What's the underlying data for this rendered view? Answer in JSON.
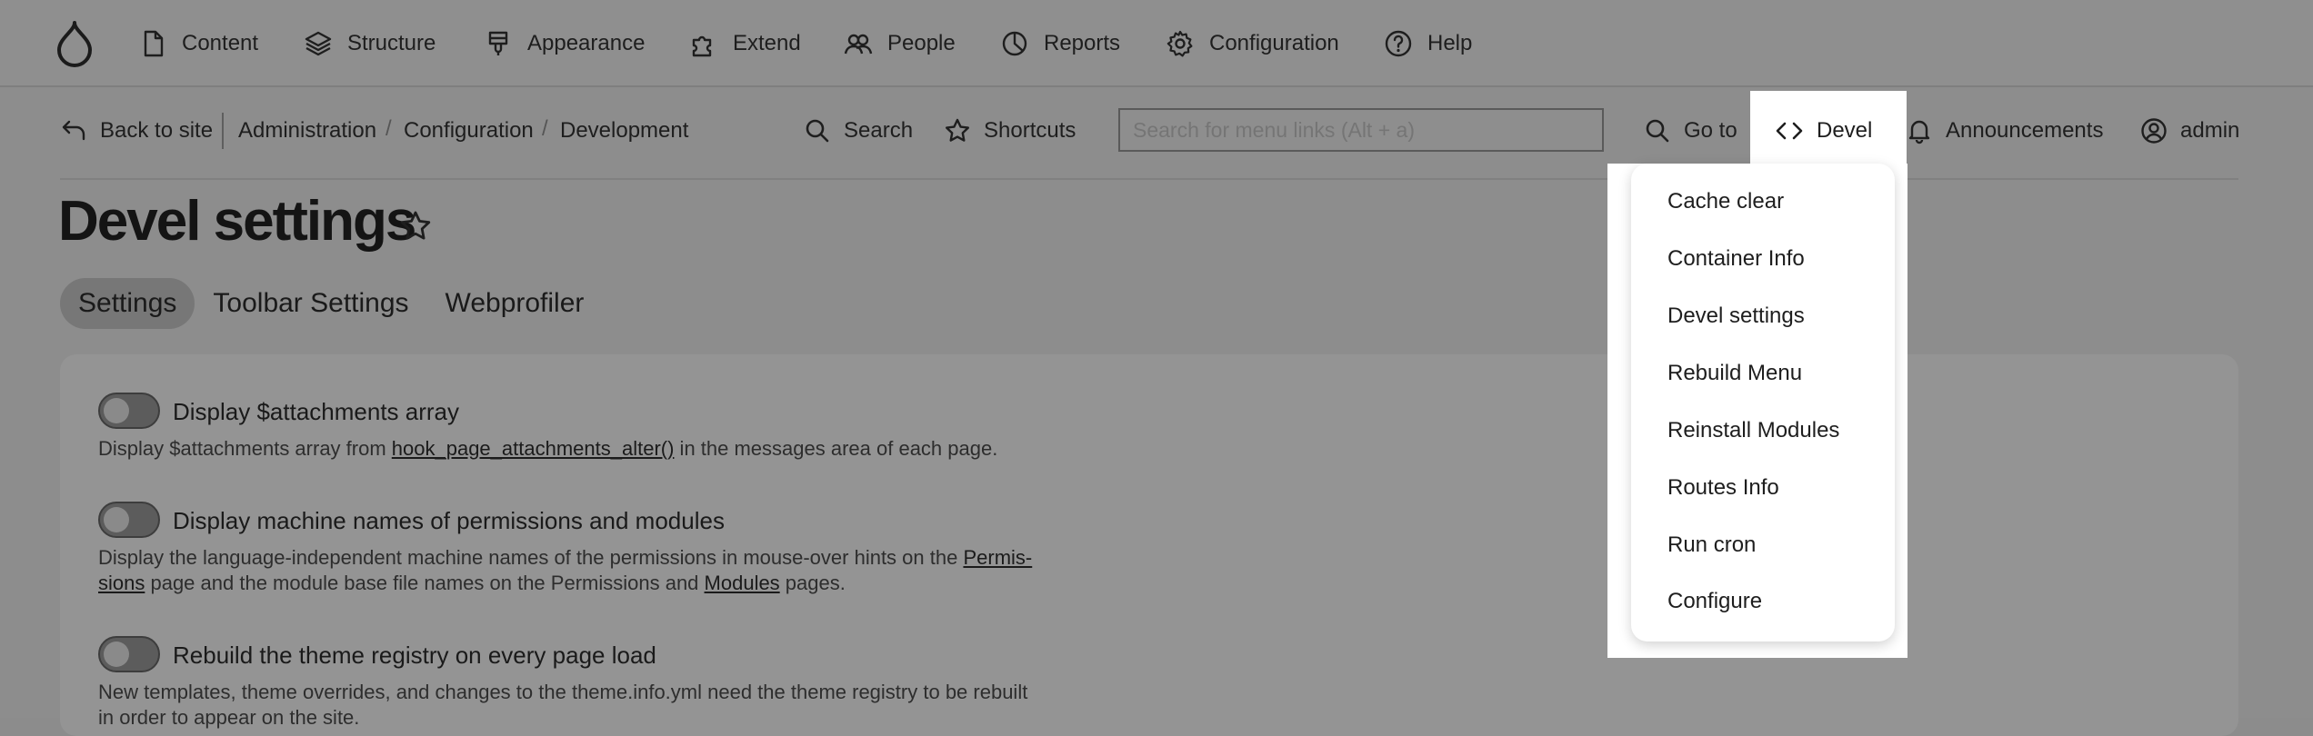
{
  "nav": {
    "items": [
      {
        "label": "Content",
        "icon": "file-icon"
      },
      {
        "label": "Structure",
        "icon": "layers-icon"
      },
      {
        "label": "Appearance",
        "icon": "brush-icon"
      },
      {
        "label": "Extend",
        "icon": "puzzle-icon"
      },
      {
        "label": "People",
        "icon": "people-icon"
      },
      {
        "label": "Reports",
        "icon": "pie-chart-icon"
      },
      {
        "label": "Configuration",
        "icon": "gear-icon"
      },
      {
        "label": "Help",
        "icon": "help-icon"
      }
    ]
  },
  "toolbar": {
    "back_label": "Back to site",
    "breadcrumb": [
      "Administration",
      "Configuration",
      "Development"
    ],
    "search_label": "Search",
    "shortcuts_label": "Shortcuts",
    "search_placeholder": "Search for menu links (Alt + a)",
    "goto_label": "Go to",
    "devel_label": "Devel",
    "announcements_label": "Announcements",
    "user_label": "admin"
  },
  "page": {
    "title": "Devel settings",
    "tabs": [
      "Settings",
      "Toolbar Settings",
      "Webprofiler"
    ]
  },
  "settings": [
    {
      "label": "Display $attachments array",
      "desc_pre": "Display $attachments array from ",
      "desc_link": "hook_page_attachments_alter()",
      "desc_post": " in the messages area of each page."
    },
    {
      "label": "Display machine names of permissions and modules",
      "desc_line1_pre": "Display the language-independent machine names of the permissions in mouse-over hints on the ",
      "desc_line1_link": "Permis-",
      "desc_line2_link": "sions",
      "desc_line2_mid": " page and the module base file names on the Permissions and ",
      "desc_line2_link2": "Modules",
      "desc_line2_post": " pages."
    },
    {
      "label": "Rebuild the theme registry on every page load",
      "desc_line1": "New templates, theme overrides, and changes to the theme.info.yml need the theme registry to be rebuilt",
      "desc_line2": "in order to appear on the site."
    }
  ],
  "devel_menu": {
    "items": [
      "Cache clear",
      "Container Info",
      "Devel settings",
      "Rebuild Menu",
      "Reinstall Modules",
      "Routes Info",
      "Run cron",
      "Configure"
    ]
  }
}
